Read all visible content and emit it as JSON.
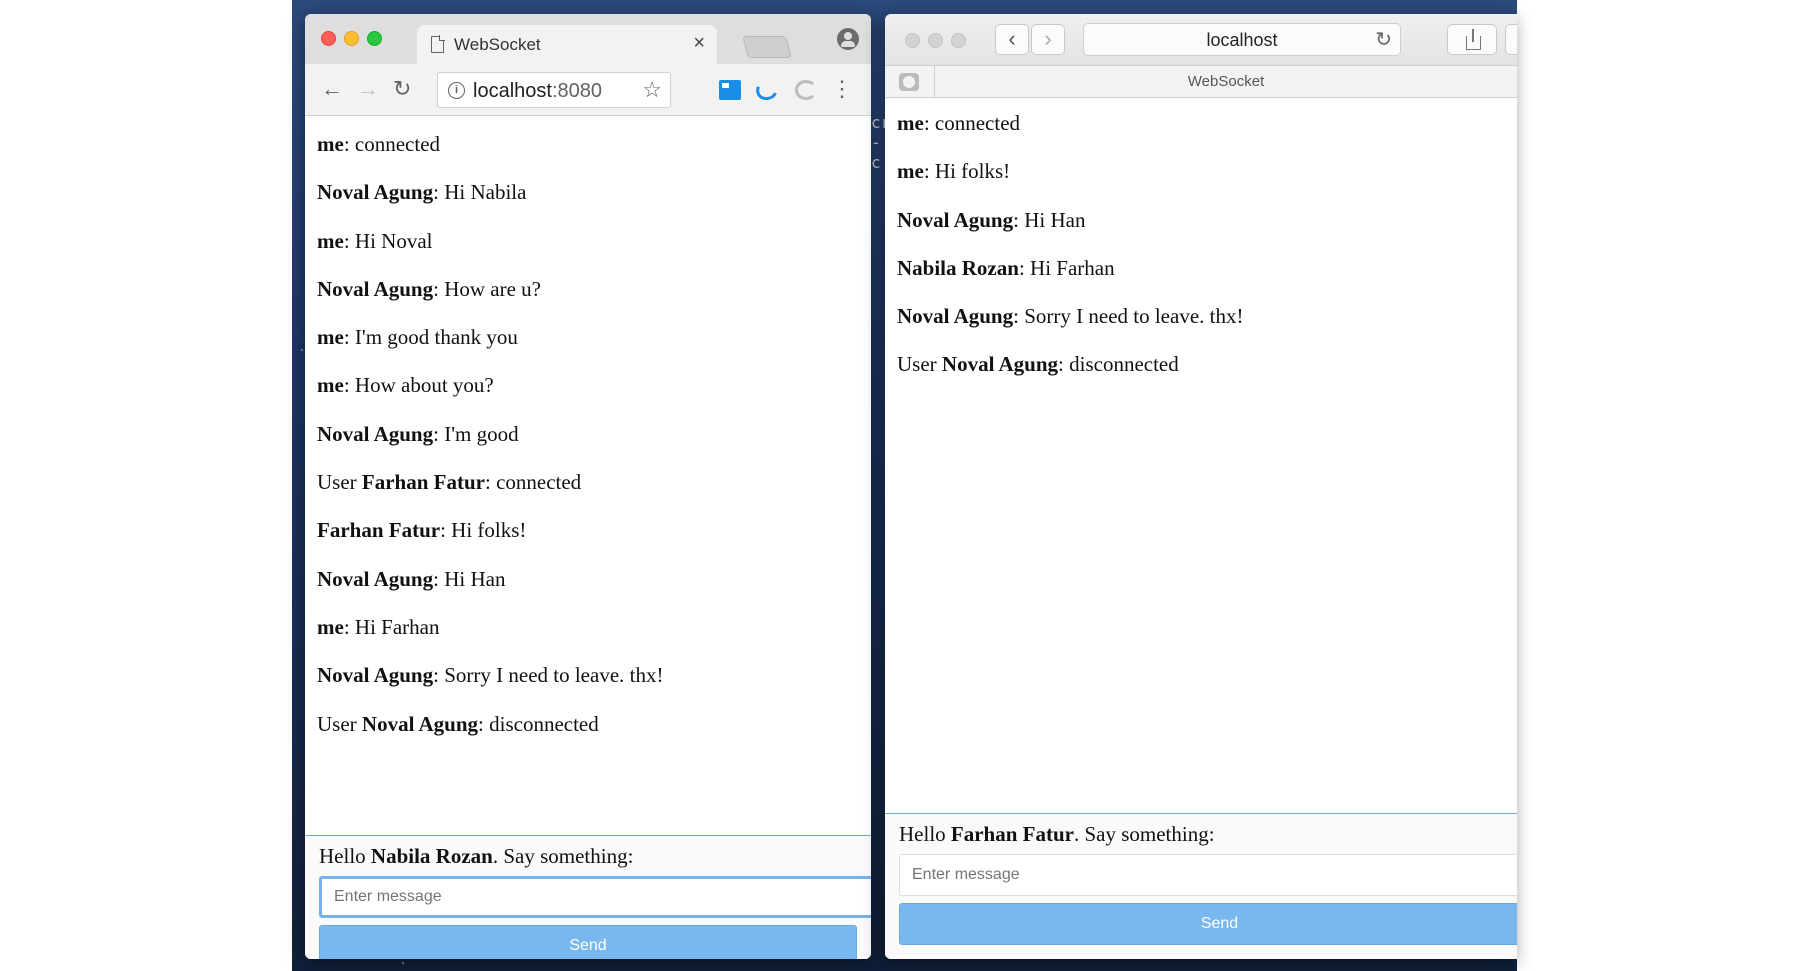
{
  "chrome": {
    "tab_title": "WebSocket",
    "tab_close": "×",
    "url_host": "localhost",
    "url_port": ":8080",
    "nav": {
      "back": "←",
      "forward": "→",
      "reload": "↻",
      "star": "☆",
      "menu": "⋮",
      "info": "i"
    },
    "messages": [
      {
        "prefix": "",
        "bold": "me",
        "text": ": connected"
      },
      {
        "prefix": "",
        "bold": "Noval Agung",
        "text": ": Hi Nabila"
      },
      {
        "prefix": "",
        "bold": "me",
        "text": ": Hi Noval"
      },
      {
        "prefix": "",
        "bold": "Noval Agung",
        "text": ": How are u?"
      },
      {
        "prefix": "",
        "bold": "me",
        "text": ": I'm good thank you"
      },
      {
        "prefix": "",
        "bold": "me",
        "text": ": How about you?"
      },
      {
        "prefix": "",
        "bold": "Noval Agung",
        "text": ": I'm good"
      },
      {
        "prefix": "User ",
        "bold": "Farhan Fatur",
        "text": ": connected"
      },
      {
        "prefix": "",
        "bold": "Farhan Fatur",
        "text": ": Hi folks!"
      },
      {
        "prefix": "",
        "bold": "Noval Agung",
        "text": ": Hi Han"
      },
      {
        "prefix": "",
        "bold": "me",
        "text": ": Hi Farhan"
      },
      {
        "prefix": "",
        "bold": "Noval Agung",
        "text": ": Sorry I need to leave. thx!"
      },
      {
        "prefix": "User ",
        "bold": "Noval Agung",
        "text": ": disconnected"
      }
    ],
    "greeting": {
      "prefix": "Hello ",
      "name": "Nabila Rozan",
      "suffix": ". Say something:"
    },
    "input_placeholder": "Enter message",
    "send_label": "Send"
  },
  "safari": {
    "url": "localhost",
    "tab_title": "WebSocket",
    "nav": {
      "back": "‹",
      "forward": "›",
      "reload": "↻"
    },
    "messages": [
      {
        "prefix": "",
        "bold": "me",
        "text": ": connected"
      },
      {
        "prefix": "",
        "bold": "me",
        "text": ": Hi folks!"
      },
      {
        "prefix": "",
        "bold": "Noval Agung",
        "text": ": Hi Han"
      },
      {
        "prefix": "",
        "bold": "Nabila Rozan",
        "text": ": Hi Farhan"
      },
      {
        "prefix": "",
        "bold": "Noval Agung",
        "text": ": Sorry I need to leave. thx!"
      },
      {
        "prefix": "User ",
        "bold": "Noval Agung",
        "text": ": disconnected"
      }
    ],
    "greeting": {
      "prefix": "Hello ",
      "name": "Farhan Fatur",
      "suffix": ". Say something:"
    },
    "input_placeholder": "Enter message",
    "send_label": "Send"
  },
  "terminal_peek": [
    "cr",
    "-c"
  ],
  "colors": {
    "send_button": "#79b8ef",
    "input_focus_border": "#7ab0e8",
    "close": "#fe5f57",
    "minimize": "#febc2e",
    "maximize": "#28c840"
  },
  "icons": {
    "chrome_tab": "document-icon",
    "chrome_info": "info-icon",
    "chrome_star": "star-icon",
    "chrome_ext_1": "extension-icon",
    "chrome_ext_2": "jquery-extension-icon",
    "chrome_ext_3": "reload-extension-icon",
    "chrome_profile": "profile-icon",
    "safari_share": "share-icon",
    "safari_tab": "tab-overview-icon"
  }
}
